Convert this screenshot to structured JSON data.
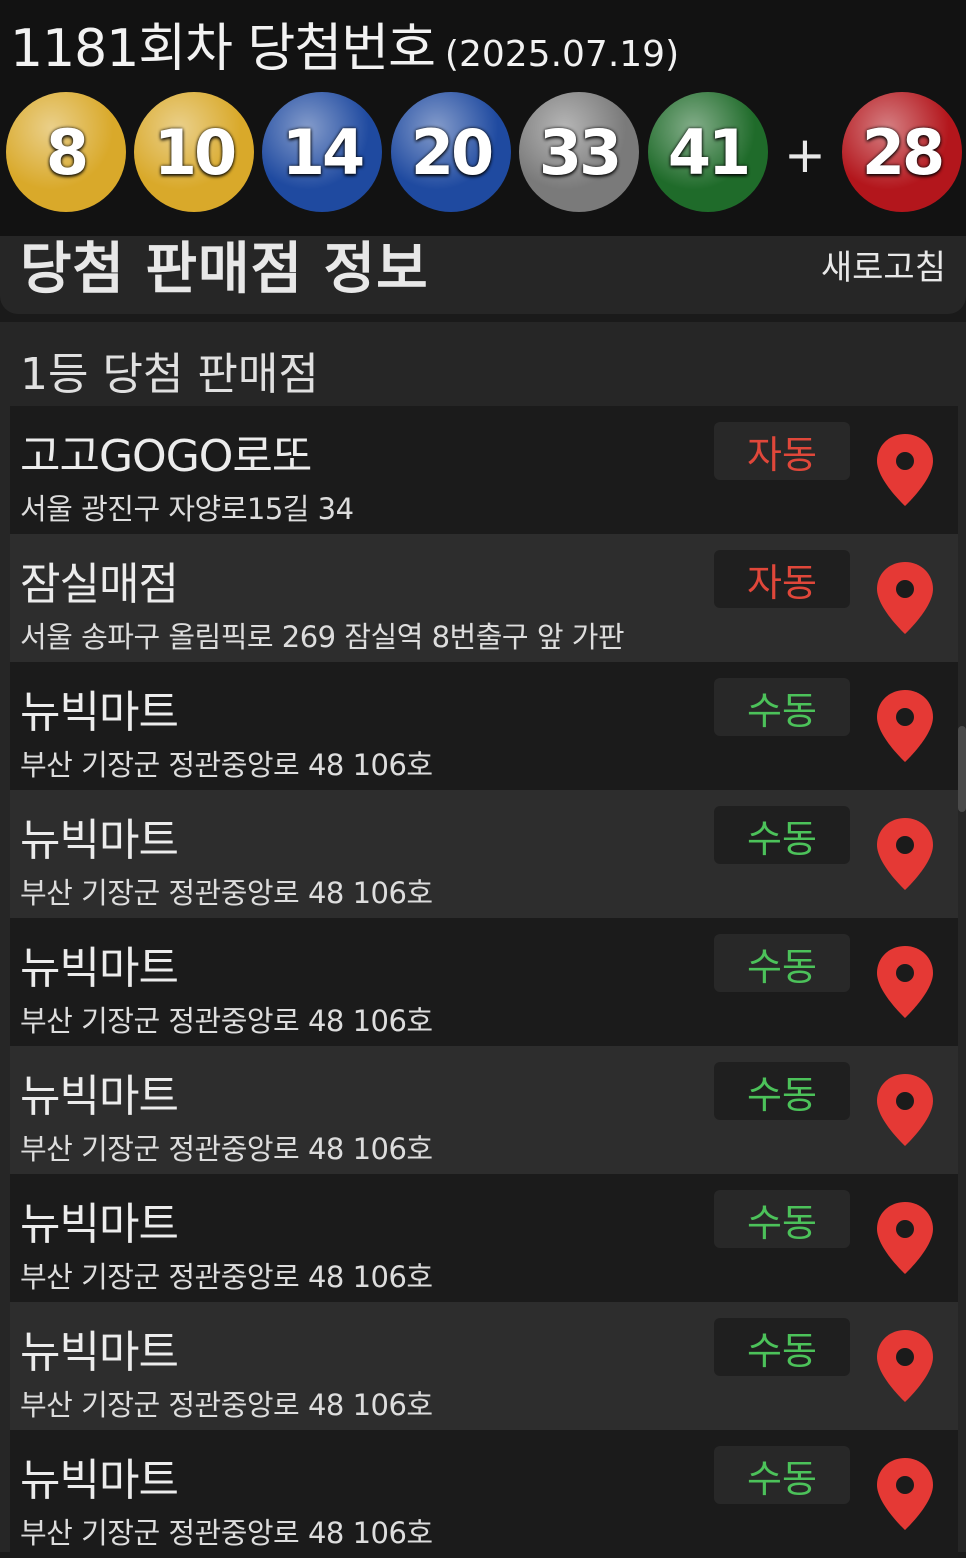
{
  "header": {
    "draw_title": "1181회차 당첨번호",
    "draw_date": "(2025.07.19)",
    "balls": [
      {
        "number": "8",
        "color": "#d9a92a"
      },
      {
        "number": "10",
        "color": "#d9a92a"
      },
      {
        "number": "14",
        "color": "#1f4aa0"
      },
      {
        "number": "20",
        "color": "#1f4aa0"
      },
      {
        "number": "33",
        "color": "#7a7a7a"
      },
      {
        "number": "41",
        "color": "#1f6b2a"
      }
    ],
    "plus": "+",
    "bonus": {
      "number": "28",
      "color": "#b3161c"
    }
  },
  "info_card": {
    "title": "당첨 판매점 정보",
    "refresh_label": "새로고침"
  },
  "section": {
    "title": "1등 당첨 판매점"
  },
  "badge_colors": {
    "자동": "#e0473a",
    "수동": "#4cc25a"
  },
  "pin_color": "#e53935",
  "stores": [
    {
      "name": "고고GOGO로또",
      "address": "서울 광진구 자양로15길 34",
      "type": "자동"
    },
    {
      "name": "잠실매점",
      "address": "서울 송파구 올림픽로 269 잠실역 8번출구 앞 가판",
      "type": "자동"
    },
    {
      "name": "뉴빅마트",
      "address": "부산 기장군 정관중앙로 48 106호",
      "type": "수동"
    },
    {
      "name": "뉴빅마트",
      "address": "부산 기장군 정관중앙로 48 106호",
      "type": "수동"
    },
    {
      "name": "뉴빅마트",
      "address": "부산 기장군 정관중앙로 48 106호",
      "type": "수동"
    },
    {
      "name": "뉴빅마트",
      "address": "부산 기장군 정관중앙로 48 106호",
      "type": "수동"
    },
    {
      "name": "뉴빅마트",
      "address": "부산 기장군 정관중앙로 48 106호",
      "type": "수동"
    },
    {
      "name": "뉴빅마트",
      "address": "부산 기장군 정관중앙로 48 106호",
      "type": "수동"
    },
    {
      "name": "뉴빅마트",
      "address": "부산 기장군 정관중앙로 48 106호",
      "type": "수동"
    }
  ]
}
